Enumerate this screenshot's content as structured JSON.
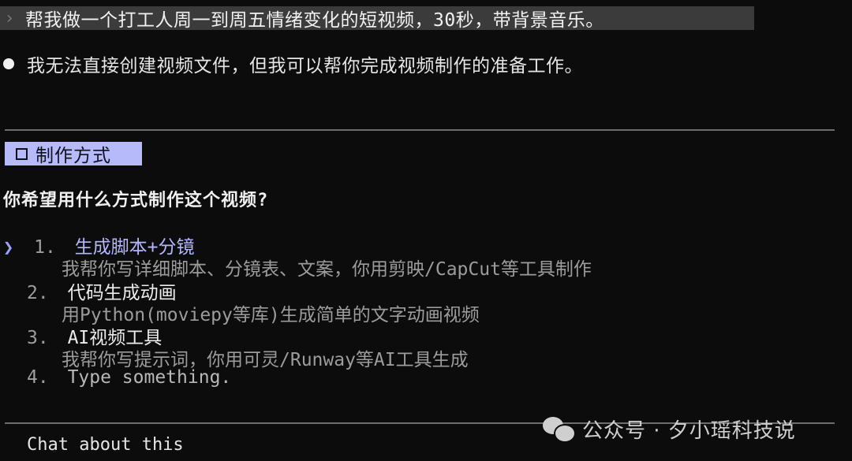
{
  "prompt": {
    "caret": "›",
    "text": "帮我做一个打工人周一到周五情绪变化的短视频，30秒，带背景音乐。"
  },
  "reply": {
    "text": "我无法直接创建视频文件，但我可以帮你完成视频制作的准备工作。"
  },
  "section": {
    "chip_label": "制作方式",
    "question": "你希望用什么方式制作这个视频?"
  },
  "options": [
    {
      "number": "1.",
      "label": "生成脚本+分镜",
      "description": "我帮你写详细脚本、分镜表、文案，你用剪映/CapCut等工具制作",
      "selected": true
    },
    {
      "number": "2.",
      "label": "代码生成动画",
      "description": "用Python(moviepy等库)生成简单的文字动画视频",
      "selected": false
    },
    {
      "number": "3.",
      "label": "AI视频工具",
      "description": "我帮你写提示词，你用可灵/Runway等AI工具生成",
      "selected": false
    },
    {
      "number": "4.",
      "label": "Type something.",
      "description": "",
      "selected": false
    }
  ],
  "cursor_glyph": "❯",
  "chat_about": "Chat about this",
  "watermark": "公众号 · 夕小瑶科技说",
  "colors": {
    "background": "#0c0c0c",
    "chip_bg": "#b6b9fa",
    "accent": "#b3b6ff"
  }
}
